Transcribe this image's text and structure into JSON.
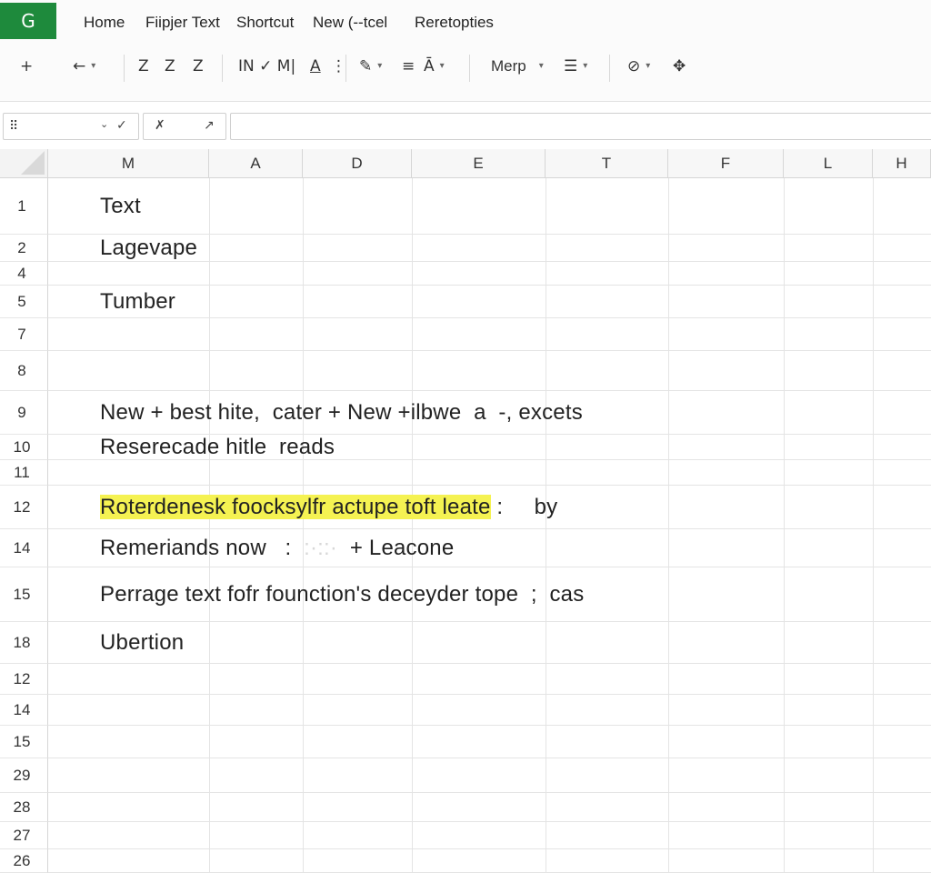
{
  "app": {
    "logo_letter": "G"
  },
  "menu": [
    "Home",
    "Fiipjer Text",
    "Shortcut",
    "New (--tcel",
    "Reretopties"
  ],
  "toolbar": {
    "add": "+",
    "undo": "←",
    "format_a": "Z",
    "format_b": "Z",
    "format_c": "Z",
    "font_group": "IN ✓ M|",
    "font_color": "A",
    "more_1": "⋮",
    "paint": "✎",
    "align": "≡",
    "text_fmt": "Ā",
    "merge": "Merp",
    "list": "☰",
    "link": "⊘",
    "tool": "✥"
  },
  "formula_bar": {
    "name_box": "",
    "cancel": "✓",
    "fx_a": "✗",
    "fx_b": "↗",
    "value": ""
  },
  "columns": [
    "M",
    "A",
    "D",
    "E",
    "T",
    "F",
    "L",
    "H"
  ],
  "rows": [
    {
      "num": "1",
      "text": "Text"
    },
    {
      "num": "2",
      "text": "Lagevape"
    },
    {
      "num": "4",
      "text": ""
    },
    {
      "num": "5",
      "text": "Tumber"
    },
    {
      "num": "7",
      "text": ""
    },
    {
      "num": "8",
      "text": ""
    },
    {
      "num": "9",
      "text": "New + best hite,  cater + New +ilbwe  a  -, excets"
    },
    {
      "num": "10",
      "text": "Reserecade hitle  reads"
    },
    {
      "num": "11",
      "text": ""
    },
    {
      "num": "12",
      "text": "Roterdenesk foocksylfr actupe toft leate",
      "after": " :     by"
    },
    {
      "num": "14",
      "text": "Remeriands now   :  ",
      "blurred": ":·::·",
      "after": "  + Leacone"
    },
    {
      "num": "15",
      "text": "Perrage text fofr founction's deceyder tope  ;  cas"
    },
    {
      "num": "18",
      "text": "Ubertion"
    },
    {
      "num": "12",
      "text": ""
    },
    {
      "num": "14",
      "text": ""
    },
    {
      "num": "15",
      "text": ""
    },
    {
      "num": "29",
      "text": ""
    },
    {
      "num": "28",
      "text": ""
    },
    {
      "num": "27",
      "text": ""
    },
    {
      "num": "26",
      "text": ""
    }
  ],
  "colors": {
    "logo": "#1e8a3c",
    "highlight": "#f5f252"
  }
}
